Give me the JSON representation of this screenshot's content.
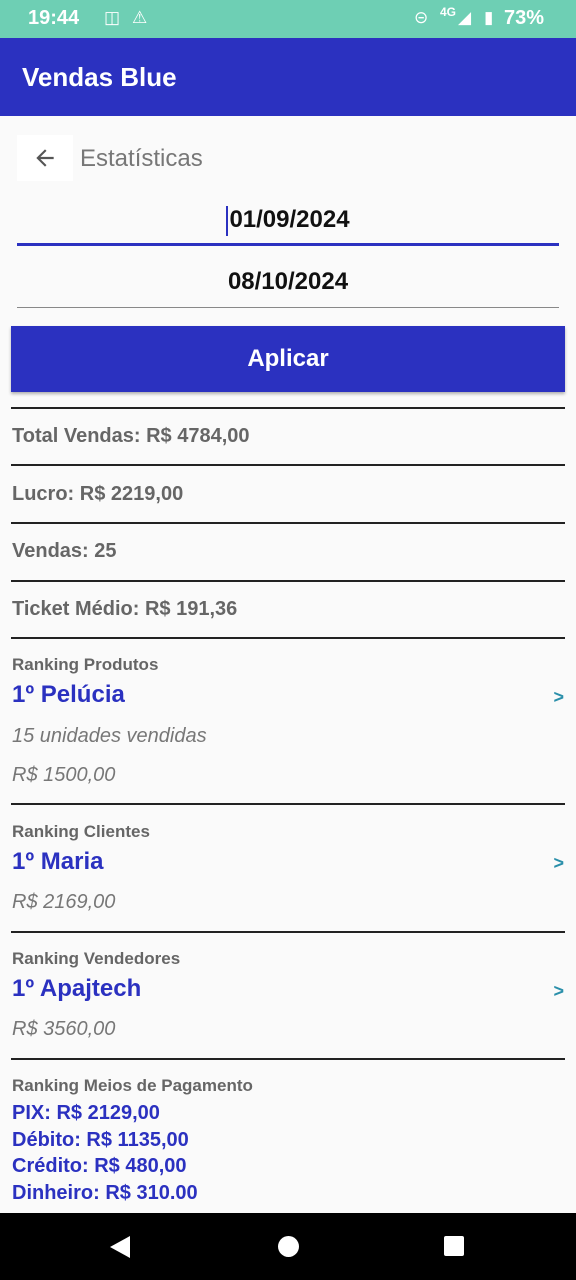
{
  "status_bar": {
    "time": "19:44",
    "network": "4G",
    "battery": "73%"
  },
  "app": {
    "title": "Vendas Blue"
  },
  "page": {
    "title": "Estatísticas"
  },
  "filters": {
    "start_date": "01/09/2024",
    "end_date": "08/10/2024",
    "apply_label": "Aplicar"
  },
  "stats": {
    "total_vendas": "Total Vendas: R$ 4784,00",
    "lucro": "Lucro: R$ 2219,00",
    "vendas": "Vendas: 25",
    "ticket_medio": "Ticket Médio: R$ 191,36"
  },
  "ranking_produtos": {
    "label": "Ranking Produtos",
    "name": "1º Pelúcia",
    "units": "15 unidades vendidas",
    "value": "R$ 1500,00",
    "chevron": ">"
  },
  "ranking_clientes": {
    "label": "Ranking Clientes",
    "name": "1º Maria",
    "value": "R$ 2169,00",
    "chevron": ">"
  },
  "ranking_vendedores": {
    "label": "Ranking Vendedores",
    "name": "1º Apajtech",
    "value": "R$ 3560,00",
    "chevron": ">"
  },
  "ranking_pagamentos": {
    "label": "Ranking Meios de Pagamento",
    "items": [
      "PIX: R$ 2129,00",
      "Débito: R$ 1135,00",
      "Crédito: R$ 480,00",
      "Dinheiro: R$ 310.00"
    ]
  },
  "icons": {
    "back": "arrow-left-icon",
    "nav_back": "triangle-back-icon",
    "nav_home": "circle-home-icon",
    "nav_recent": "square-recent-icon"
  },
  "colors": {
    "primary": "#2b31c0",
    "status_bar": "#6ecfb4",
    "accent_chevron": "#2a8faa"
  }
}
